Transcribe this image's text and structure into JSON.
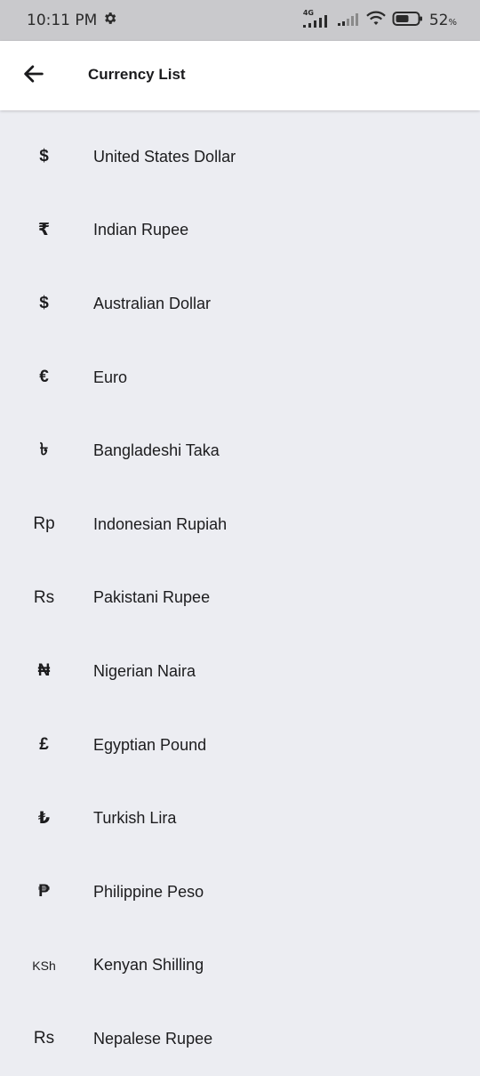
{
  "status_bar": {
    "time": "10:11 PM",
    "network": "4G",
    "battery": "52"
  },
  "app_bar": {
    "title": "Currency List"
  },
  "currencies": [
    {
      "symbol": "$",
      "name": "United States Dollar"
    },
    {
      "symbol": "₹",
      "name": "Indian Rupee"
    },
    {
      "symbol": "$",
      "name": "Australian Dollar"
    },
    {
      "symbol": "€",
      "name": "Euro"
    },
    {
      "symbol": "৳",
      "name": "Bangladeshi Taka"
    },
    {
      "symbol": "Rp",
      "name": "Indonesian Rupiah"
    },
    {
      "symbol": "Rs",
      "name": "Pakistani Rupee"
    },
    {
      "symbol": "₦",
      "name": "Nigerian Naira"
    },
    {
      "symbol": "£",
      "name": "Egyptian Pound"
    },
    {
      "symbol": "₺",
      "name": "Turkish Lira"
    },
    {
      "symbol": "₱",
      "name": "Philippine Peso"
    },
    {
      "symbol": "KSh",
      "name": "Kenyan Shilling"
    },
    {
      "symbol": "Rs",
      "name": "Nepalese Rupee"
    }
  ]
}
